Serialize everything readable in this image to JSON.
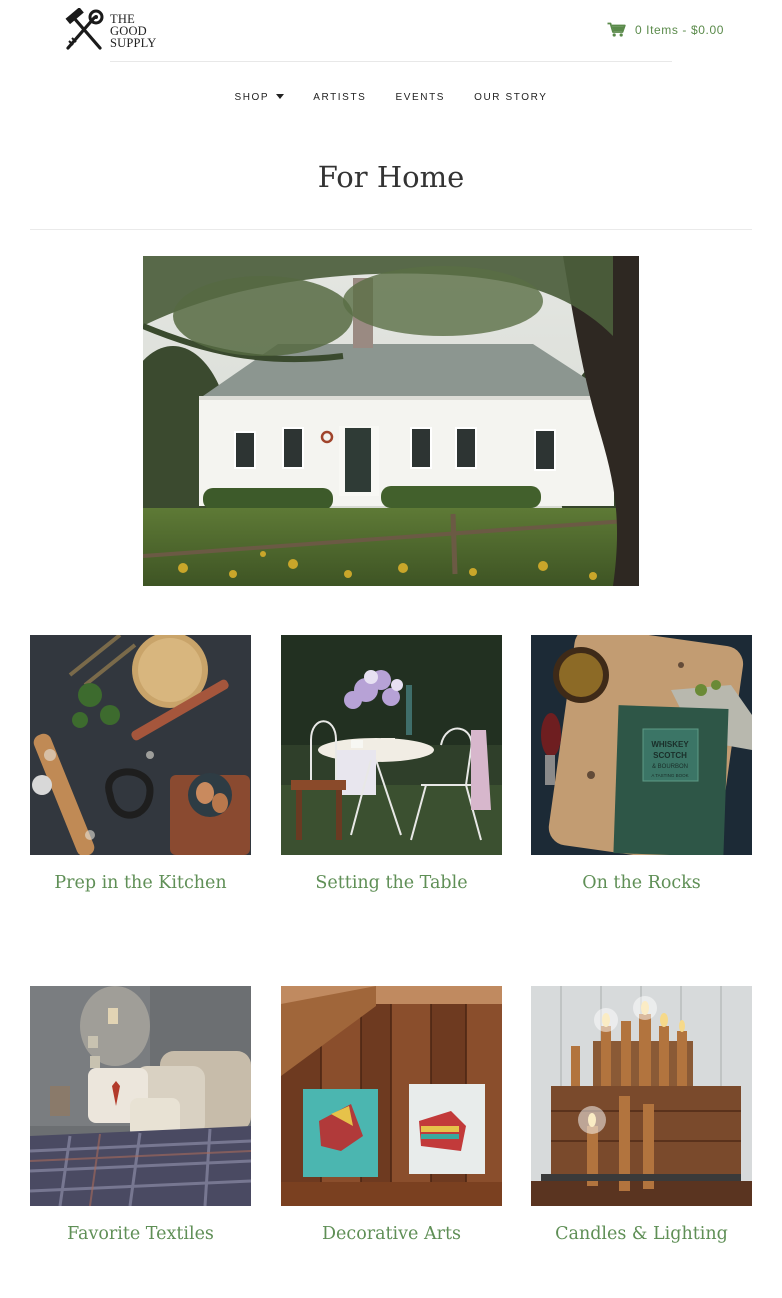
{
  "brand": {
    "logo_lines": [
      "THE",
      "GOOD",
      "SUPPLY"
    ]
  },
  "cart": {
    "label": "0 Items - $0.00"
  },
  "nav": {
    "items": [
      {
        "label": "SHOP",
        "has_dropdown": true
      },
      {
        "label": "ARTISTS"
      },
      {
        "label": "EVENTS"
      },
      {
        "label": "OUR STORY"
      }
    ]
  },
  "page": {
    "title": "For Home"
  },
  "categories": [
    {
      "label": "Prep in the Kitchen"
    },
    {
      "label": "Setting the Table"
    },
    {
      "label": "On the Rocks"
    },
    {
      "label": "Favorite Textiles"
    },
    {
      "label": "Decorative Arts"
    },
    {
      "label": "Candles & Lighting"
    }
  ],
  "book_cover_text": [
    "WHISKEY",
    "SCOTCH",
    "& BOURBON",
    "A TASTING BOOK"
  ],
  "colors": {
    "accent_green": "#5f8f56",
    "cart_green": "#5a8a4a"
  }
}
